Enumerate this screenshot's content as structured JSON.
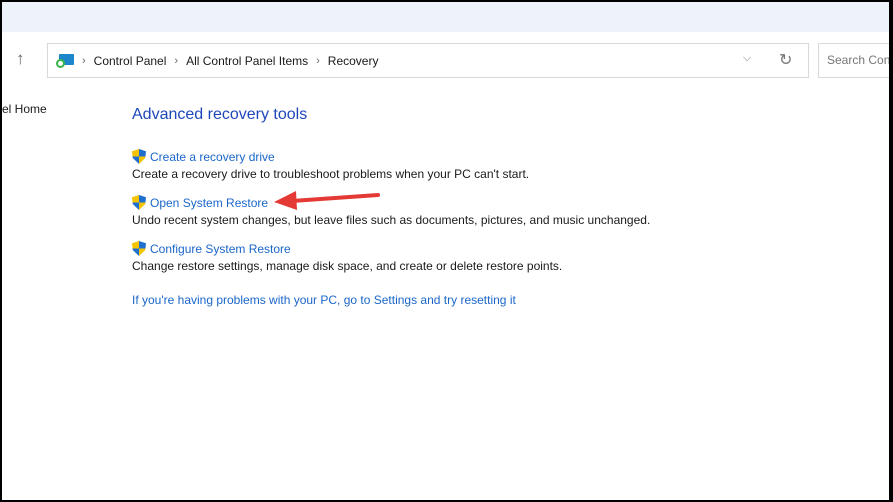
{
  "breadcrumb": [
    "Control Panel",
    "All Control Panel Items",
    "Recovery"
  ],
  "search": {
    "placeholder": "Search Control Panel"
  },
  "sidebar": {
    "home_label": "el Home"
  },
  "main": {
    "title": "Advanced recovery tools",
    "items": [
      {
        "link": "Create a recovery drive",
        "desc": "Create a recovery drive to troubleshoot problems when your PC can't start."
      },
      {
        "link": "Open System Restore",
        "desc": "Undo recent system changes, but leave files such as documents, pictures, and music unchanged."
      },
      {
        "link": "Configure System Restore",
        "desc": "Change restore settings, manage disk space, and create or delete restore points."
      }
    ],
    "reset_link": "If you're having problems with your PC, go to Settings and try resetting it"
  },
  "colors": {
    "link": "#1a66c9",
    "heading": "#1e47b9",
    "annotation": "#e53935"
  }
}
